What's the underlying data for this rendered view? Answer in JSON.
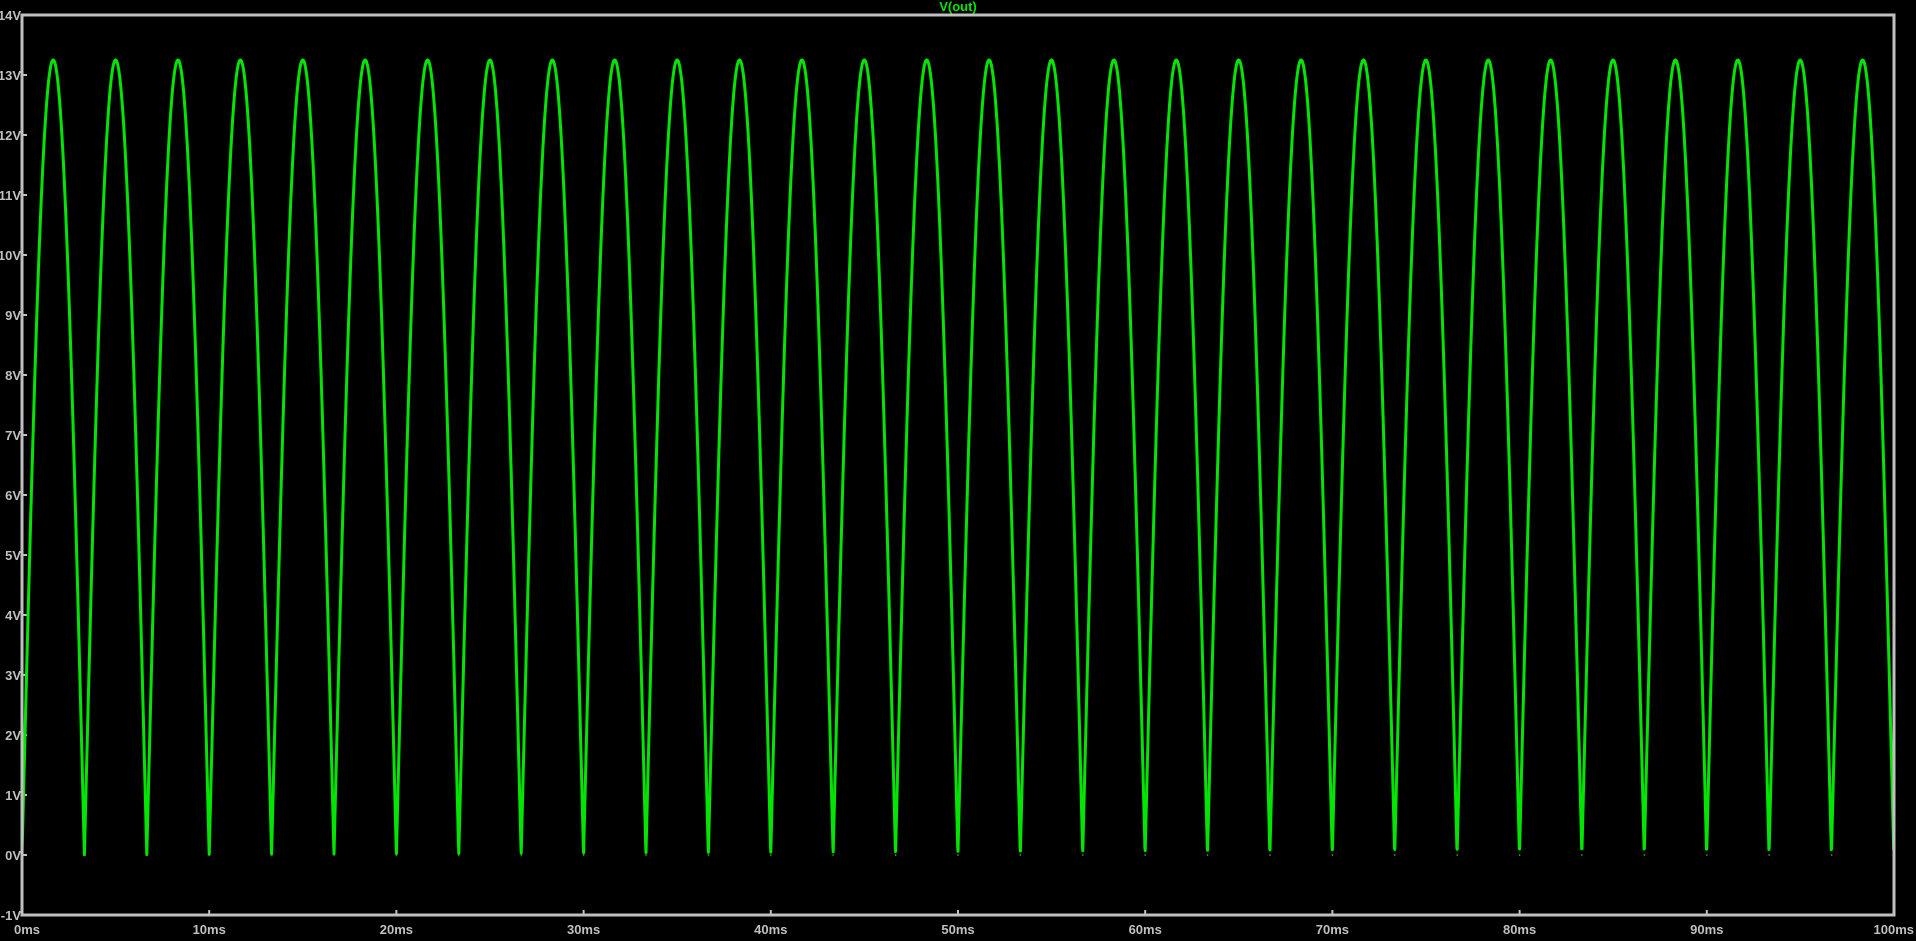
{
  "chart_data": {
    "type": "line",
    "title": "V(out)",
    "xlabel": "",
    "ylabel": "",
    "xlim": [
      0,
      100
    ],
    "ylim": [
      -1,
      14
    ],
    "x_unit": "ms",
    "y_unit": "V",
    "x_ticks": [
      "0ms",
      "10ms",
      "20ms",
      "30ms",
      "40ms",
      "50ms",
      "60ms",
      "70ms",
      "80ms",
      "90ms",
      "100ms"
    ],
    "y_ticks": [
      "-1V",
      "0V",
      "1V",
      "2V",
      "3V",
      "4V",
      "5V",
      "6V",
      "7V",
      "8V",
      "9V",
      "10V",
      "11V",
      "12V",
      "13V",
      "14V"
    ],
    "grid": false,
    "legend": "none",
    "series": [
      {
        "name": "V(out)",
        "color": "#00e600",
        "waveform": "full-wave rectified sine",
        "peak_v": 13.25,
        "trough_v": 0.0,
        "period_ms": 3.333,
        "peak_times_ms": [
          1.67,
          5.0,
          8.33,
          11.67,
          15.0,
          18.33,
          21.67,
          25.0,
          28.33,
          31.67,
          35.0,
          38.33,
          41.67,
          45.0,
          48.33,
          51.67,
          55.0,
          58.33,
          61.67,
          65.0,
          68.33,
          71.67,
          75.0,
          78.33,
          81.67,
          85.0,
          88.33,
          91.67,
          95.0,
          98.33
        ],
        "trough_times_ms": [
          0,
          3.33,
          6.67,
          10.0,
          13.33,
          16.67,
          20.0,
          23.33,
          26.67,
          30.0,
          33.33,
          36.67,
          40.0,
          43.33,
          46.67,
          50.0,
          53.33,
          56.67,
          60.0,
          63.33,
          66.67,
          70.0,
          73.33,
          76.67,
          80.0,
          83.33,
          86.67,
          90.0,
          93.33,
          96.67,
          100.0
        ]
      }
    ],
    "colors": {
      "background": "#000000",
      "frame": "#c0c0c0",
      "tick_labels": "#c0c0c0",
      "title": "#00e600"
    }
  }
}
